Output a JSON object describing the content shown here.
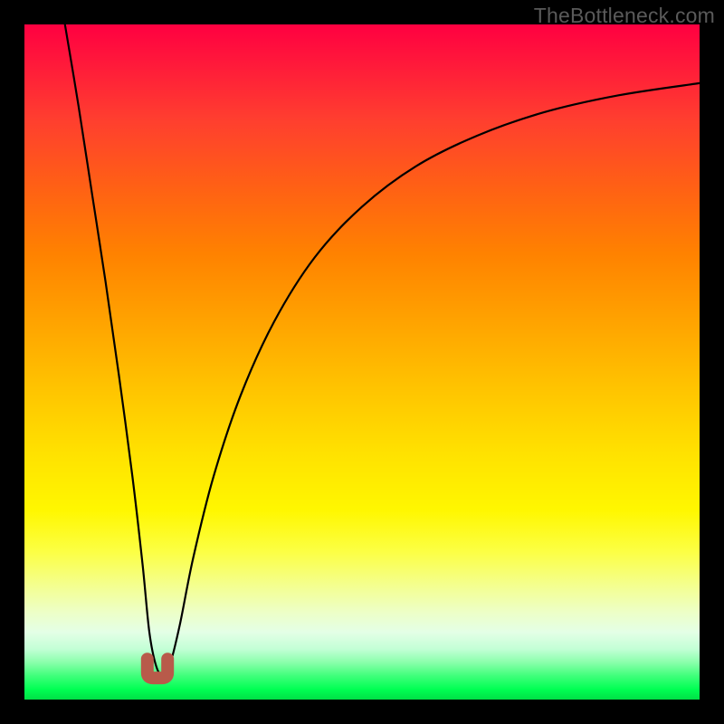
{
  "watermark": "TheBottleneck.com",
  "chart_data": {
    "type": "line",
    "title": "",
    "xlabel": "",
    "ylabel": "",
    "xlim": [
      0,
      100
    ],
    "ylim": [
      0,
      100
    ],
    "grid": false,
    "legend": false,
    "series": [
      {
        "name": "bottleneck-curve",
        "x": [
          6,
          8,
          10,
          12,
          14,
          16,
          17.5,
          18.5,
          19.5,
          20.5,
          21.5,
          23,
          25,
          28,
          32,
          37,
          43,
          50,
          58,
          67,
          77,
          88,
          100
        ],
        "values": [
          100,
          88,
          75,
          62,
          48,
          33,
          20,
          10,
          5,
          3.5,
          5,
          11,
          21,
          33,
          45,
          56,
          65.5,
          73,
          79,
          83.5,
          87,
          89.5,
          91.3
        ]
      }
    ],
    "marker": {
      "name": "min-marker",
      "x_range": [
        18.2,
        21.2
      ],
      "y": 3.2,
      "color": "#b85a4a"
    },
    "gradient_stops": [
      {
        "pos": 0,
        "color": "#ff0041"
      },
      {
        "pos": 6,
        "color": "#ff1a3a"
      },
      {
        "pos": 14,
        "color": "#ff3e2f"
      },
      {
        "pos": 24,
        "color": "#ff6015"
      },
      {
        "pos": 34,
        "color": "#ff8200"
      },
      {
        "pos": 44,
        "color": "#ffa300"
      },
      {
        "pos": 54,
        "color": "#ffc400"
      },
      {
        "pos": 64,
        "color": "#ffe300"
      },
      {
        "pos": 72,
        "color": "#fff700"
      },
      {
        "pos": 78,
        "color": "#fcff43"
      },
      {
        "pos": 83,
        "color": "#f4ff8e"
      },
      {
        "pos": 87,
        "color": "#edffc6"
      },
      {
        "pos": 90,
        "color": "#e4ffe6"
      },
      {
        "pos": 92.5,
        "color": "#c3ffd6"
      },
      {
        "pos": 94.5,
        "color": "#8affab"
      },
      {
        "pos": 96.5,
        "color": "#3fff7a"
      },
      {
        "pos": 98.5,
        "color": "#00ff53"
      },
      {
        "pos": 100,
        "color": "#00e046"
      }
    ]
  }
}
